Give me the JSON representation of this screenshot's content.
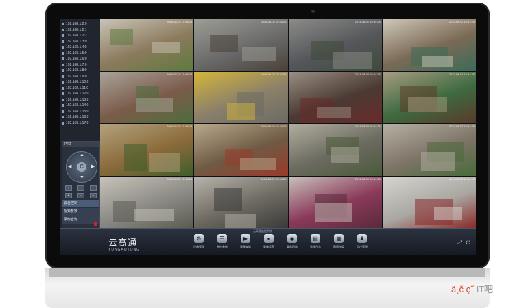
{
  "sidebar": {
    "devices": [
      "192.168.1.2:0",
      "192.168.1.2:1",
      "192.168.1.2:2",
      "192.168.1.3:0",
      "192.168.1.4:0",
      "192.168.1.5:0",
      "192.168.1.6:0",
      "192.168.1.7:0",
      "192.168.1.8:0",
      "192.168.1.9:0",
      "192.168.1.10:0",
      "192.168.1.11:0",
      "192.168.1.12:0",
      "192.168.1.13:0",
      "192.168.1.14:0",
      "192.168.1.15:0",
      "192.168.1.16:0",
      "192.168.1.17:0"
    ],
    "ptz_title": "PTZ",
    "ptz_center_icon": "C",
    "tabs": [
      "云台控制",
      "视频参数",
      "录像查询"
    ]
  },
  "grid": {
    "tiles": [
      {
        "ts": "2014-08-02 15:44:25",
        "scene": "village-road",
        "colors": [
          "#8b7a5c",
          "#c9c4b8",
          "#5e7a3f"
        ]
      },
      {
        "ts": "2014-08-02 15:44:25",
        "scene": "street-scooters",
        "colors": [
          "#6a6a6a",
          "#9d9d96",
          "#4a4037"
        ]
      },
      {
        "ts": "2014-08-02 15:44:25",
        "scene": "road-cars",
        "colors": [
          "#55565a",
          "#8b8c88",
          "#3e4a3a"
        ]
      },
      {
        "ts": "2014-08-02 15:44:25",
        "scene": "shop-counter",
        "colors": [
          "#7a6a55",
          "#cfc8b8",
          "#3b6b5a"
        ]
      },
      {
        "ts": "2014-08-02 15:44:25",
        "scene": "houses",
        "colors": [
          "#7b5b4a",
          "#a9a39a",
          "#4d6e3c"
        ]
      },
      {
        "ts": "2014-08-02 15:44:25",
        "scene": "gate-posts",
        "colors": [
          "#8a7f6a",
          "#d4b53a",
          "#6b6b63"
        ]
      },
      {
        "ts": "2014-08-02 15:44:25",
        "scene": "clothing-store",
        "colors": [
          "#4a3a33",
          "#9a8e82",
          "#6a2a2a"
        ]
      },
      {
        "ts": "2014-08-02 15:44:25",
        "scene": "pharmacy",
        "colors": [
          "#3e6a3f",
          "#a89c82",
          "#5a3a2a"
        ]
      },
      {
        "ts": "2014-08-02 15:44:25",
        "scene": "warehouse-boxes",
        "colors": [
          "#8a6a3a",
          "#b3a27e",
          "#3f5d2b"
        ]
      },
      {
        "ts": "2014-08-02 15:44:25",
        "scene": "supermarket",
        "colors": [
          "#6f5a44",
          "#b8a98c",
          "#9a3a2a"
        ]
      },
      {
        "ts": "2014-08-02 15:44:25",
        "scene": "yard",
        "colors": [
          "#6b6a5f",
          "#b2ada0",
          "#4a5a3a"
        ]
      },
      {
        "ts": "2014-08-02 15:44:25",
        "scene": "buildings",
        "colors": [
          "#7d7466",
          "#b6b0a4",
          "#486a3a"
        ]
      },
      {
        "ts": "2014-08-02 15:44:25",
        "scene": "courtyard",
        "colors": [
          "#8c8a84",
          "#c7c3ba",
          "#5a5a52"
        ]
      },
      {
        "ts": "2014-08-02 15:44:25",
        "scene": "market-hall",
        "colors": [
          "#6e6a62",
          "#b8b4ab",
          "#3a3a38"
        ]
      },
      {
        "ts": "2014-08-02 15:44:25",
        "scene": "meeting-room",
        "colors": [
          "#8a3a5a",
          "#c9c1bb",
          "#5a2a3a"
        ]
      },
      {
        "ts": "2014-08-02 15:44:25",
        "scene": "reception",
        "colors": [
          "#a9a7a2",
          "#d8d5cf",
          "#8a2a2a"
        ]
      }
    ]
  },
  "toolbar": {
    "status": "云高通监控系统",
    "brand_cn": "云高通",
    "brand_en": "YUNGAOTONG",
    "tools": [
      {
        "label": "设备管理",
        "icon": "⚙"
      },
      {
        "label": "系统参数",
        "icon": "☰"
      },
      {
        "label": "录像查询",
        "icon": "▶"
      },
      {
        "label": "录像设置",
        "icon": "●"
      },
      {
        "label": "录像回放",
        "icon": "◉"
      },
      {
        "label": "系统日志",
        "icon": "▤"
      },
      {
        "label": "画面布局",
        "icon": "▦"
      },
      {
        "label": "用户管理",
        "icon": "♟"
      }
    ],
    "corner": [
      "⤢",
      "⏻"
    ]
  },
  "watermark": {
    "garbled": "ä¸č ç˝",
    "brand": "IT吧"
  }
}
